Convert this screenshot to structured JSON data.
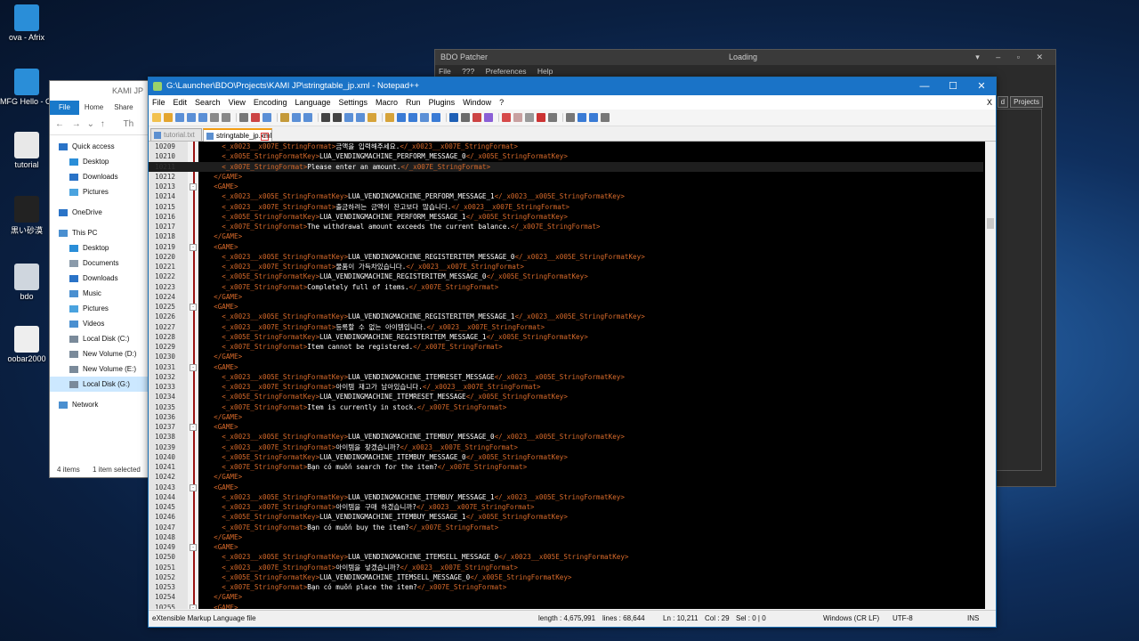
{
  "desktop": {
    "icons": [
      {
        "label": "ova - Afrix",
        "color": "#2a8ed8"
      },
      {
        "label": "MFG Hello - OMFG",
        "color": "#2a8ed8"
      },
      {
        "label": "tutorial",
        "color": "#e8e8e8"
      },
      {
        "label": "黒い砂漠",
        "color": "#222222"
      },
      {
        "label": "bdo",
        "color": "#cfd6de"
      },
      {
        "label": "oobar2000",
        "color": "#eeeeee"
      }
    ]
  },
  "bdo_patcher": {
    "title": "BDO Patcher",
    "status": "Loading",
    "menu": [
      "File",
      "???",
      "Preferences",
      "Help"
    ],
    "tabs": [
      "d",
      "Projects"
    ]
  },
  "explorer": {
    "title": "KAMI JP",
    "ribbon": {
      "file": "File",
      "home": "Home",
      "share": "Share"
    },
    "address": "Th",
    "nav": [
      {
        "label": "Quick access",
        "icon": "star-icon",
        "color": "#2a73c7",
        "sub": false
      },
      {
        "label": "Desktop",
        "icon": "desktop-icon",
        "color": "#2a8ed8",
        "sub": true
      },
      {
        "label": "Downloads",
        "icon": "download-icon",
        "color": "#2a73c7",
        "sub": true
      },
      {
        "label": "Pictures",
        "icon": "pictures-icon",
        "color": "#4aa3df",
        "sub": true
      },
      {
        "label": "OneDrive",
        "icon": "cloud-icon",
        "color": "#2a73c7",
        "sub": false,
        "gap": true
      },
      {
        "label": "This PC",
        "icon": "pc-icon",
        "color": "#4a8fd0",
        "sub": false,
        "gap": true
      },
      {
        "label": "Desktop",
        "icon": "desktop-icon",
        "color": "#2a8ed8",
        "sub": true
      },
      {
        "label": "Documents",
        "icon": "documents-icon",
        "color": "#8a9aaa",
        "sub": true
      },
      {
        "label": "Downloads",
        "icon": "download-icon",
        "color": "#2a73c7",
        "sub": true
      },
      {
        "label": "Music",
        "icon": "music-icon",
        "color": "#4a8fd0",
        "sub": true
      },
      {
        "label": "Pictures",
        "icon": "pictures-icon",
        "color": "#4aa3df",
        "sub": true
      },
      {
        "label": "Videos",
        "icon": "videos-icon",
        "color": "#4a8fd0",
        "sub": true
      },
      {
        "label": "Local Disk (C:)",
        "icon": "disk-icon",
        "color": "#7a8a9a",
        "sub": true
      },
      {
        "label": "New Volume (D:)",
        "icon": "disk-icon",
        "color": "#7a8a9a",
        "sub": true
      },
      {
        "label": "New Volume (E:)",
        "icon": "disk-icon",
        "color": "#7a8a9a",
        "sub": true
      },
      {
        "label": "Local Disk (G:)",
        "icon": "disk-icon",
        "color": "#7a8a9a",
        "sub": true,
        "selected": true
      },
      {
        "label": "Network",
        "icon": "network-icon",
        "color": "#4a8fd0",
        "sub": false,
        "gap": true
      }
    ],
    "status_items": "4 items",
    "status_selected": "1 item selected"
  },
  "notepad": {
    "title": "G:\\Launcher\\BDO\\Projects\\KAMI JP\\stringtable_jp.xml - Notepad++",
    "menu": [
      "File",
      "Edit",
      "Search",
      "View",
      "Encoding",
      "Language",
      "Settings",
      "Macro",
      "Run",
      "Plugins",
      "Window",
      "?"
    ],
    "menu_close": "X",
    "tabs": [
      {
        "label": "tutorial.txt",
        "active": false
      },
      {
        "label": "stringtable_jp.xml",
        "active": true
      }
    ],
    "accent": "#1a73c7",
    "tag_color": "#d96b2b",
    "lines": [
      {
        "no": "10209",
        "fold": "",
        "current": false,
        "segs": [
          [
            "t",
            "    <_x0023__x007E_StringFormat>"
          ],
          [
            "c",
            "금액을 입력해주세요."
          ],
          [
            "t",
            "</_x0023__x007E_StringFormat>"
          ]
        ]
      },
      {
        "no": "10210",
        "fold": "",
        "current": false,
        "segs": [
          [
            "t",
            "    <_x005E_StringFormatKey>"
          ],
          [
            "c",
            "LUA_VENDINGMACHINE_PERFORM_MESSAGE_0"
          ],
          [
            "t",
            "</_x005E_StringFormatKey>"
          ]
        ]
      },
      {
        "no": "10211",
        "fold": "",
        "current": true,
        "segs": [
          [
            "t",
            "    <_x007E_StringFormat>"
          ],
          [
            "c",
            "Please enter an amount."
          ],
          [
            "t",
            "</_x007E_StringFormat>"
          ]
        ]
      },
      {
        "no": "10212",
        "fold": "",
        "current": false,
        "segs": [
          [
            "t",
            "  </GAME>"
          ]
        ]
      },
      {
        "no": "10213",
        "fold": "-",
        "current": false,
        "segs": [
          [
            "t",
            "  <GAME>"
          ]
        ]
      },
      {
        "no": "10214",
        "fold": "",
        "current": false,
        "segs": [
          [
            "t",
            "    <_x0023__x005E_StringFormatKey>"
          ],
          [
            "c",
            "LUA_VENDINGMACHINE_PERFORM_MESSAGE_1"
          ],
          [
            "t",
            "</_x0023__x005E_StringFormatKey>"
          ]
        ]
      },
      {
        "no": "10215",
        "fold": "",
        "current": false,
        "segs": [
          [
            "t",
            "    <_x0023__x007E_StringFormat>"
          ],
          [
            "c",
            "출금하려는 금액이 잔고보다 많습니다."
          ],
          [
            "t",
            "</_x0023__x007E_StringFormat>"
          ]
        ]
      },
      {
        "no": "10216",
        "fold": "",
        "current": false,
        "segs": [
          [
            "t",
            "    <_x005E_StringFormatKey>"
          ],
          [
            "c",
            "LUA_VENDINGMACHINE_PERFORM_MESSAGE_1"
          ],
          [
            "t",
            "</_x005E_StringFormatKey>"
          ]
        ]
      },
      {
        "no": "10217",
        "fold": "",
        "current": false,
        "segs": [
          [
            "t",
            "    <_x007E_StringFormat>"
          ],
          [
            "c",
            "The withdrawal amount exceeds the current balance."
          ],
          [
            "t",
            "</_x007E_StringFormat>"
          ]
        ]
      },
      {
        "no": "10218",
        "fold": "",
        "current": false,
        "segs": [
          [
            "t",
            "  </GAME>"
          ]
        ]
      },
      {
        "no": "10219",
        "fold": "-",
        "current": false,
        "segs": [
          [
            "t",
            "  <GAME>"
          ]
        ]
      },
      {
        "no": "10220",
        "fold": "",
        "current": false,
        "segs": [
          [
            "t",
            "    <_x0023__x005E_StringFormatKey>"
          ],
          [
            "c",
            "LUA_VENDINGMACHINE_REGISTERITEM_MESSAGE_0"
          ],
          [
            "t",
            "</_x0023__x005E_StringFormatKey>"
          ]
        ]
      },
      {
        "no": "10221",
        "fold": "",
        "current": false,
        "segs": [
          [
            "t",
            "    <_x0023__x007E_StringFormat>"
          ],
          [
            "c",
            "물품이 가득차있습니다."
          ],
          [
            "t",
            "</_x0023__x007E_StringFormat>"
          ]
        ]
      },
      {
        "no": "10222",
        "fold": "",
        "current": false,
        "segs": [
          [
            "t",
            "    <_x005E_StringFormatKey>"
          ],
          [
            "c",
            "LUA_VENDINGMACHINE_REGISTERITEM_MESSAGE_0"
          ],
          [
            "t",
            "</_x005E_StringFormatKey>"
          ]
        ]
      },
      {
        "no": "10223",
        "fold": "",
        "current": false,
        "segs": [
          [
            "t",
            "    <_x007E_StringFormat>"
          ],
          [
            "c",
            "Completely full of items."
          ],
          [
            "t",
            "</_x007E_StringFormat>"
          ]
        ]
      },
      {
        "no": "10224",
        "fold": "",
        "current": false,
        "segs": [
          [
            "t",
            "  </GAME>"
          ]
        ]
      },
      {
        "no": "10225",
        "fold": "-",
        "current": false,
        "segs": [
          [
            "t",
            "  <GAME>"
          ]
        ]
      },
      {
        "no": "10226",
        "fold": "",
        "current": false,
        "segs": [
          [
            "t",
            "    <_x0023__x005E_StringFormatKey>"
          ],
          [
            "c",
            "LUA_VENDINGMACHINE_REGISTERITEM_MESSAGE_1"
          ],
          [
            "t",
            "</_x0023__x005E_StringFormatKey>"
          ]
        ]
      },
      {
        "no": "10227",
        "fold": "",
        "current": false,
        "segs": [
          [
            "t",
            "    <_x0023__x007E_StringFormat>"
          ],
          [
            "c",
            "등록할 수 없는 아이템입니다."
          ],
          [
            "t",
            "</_x0023__x007E_StringFormat>"
          ]
        ]
      },
      {
        "no": "10228",
        "fold": "",
        "current": false,
        "segs": [
          [
            "t",
            "    <_x005E_StringFormatKey>"
          ],
          [
            "c",
            "LUA_VENDINGMACHINE_REGISTERITEM_MESSAGE_1"
          ],
          [
            "t",
            "</_x005E_StringFormatKey>"
          ]
        ]
      },
      {
        "no": "10229",
        "fold": "",
        "current": false,
        "segs": [
          [
            "t",
            "    <_x007E_StringFormat>"
          ],
          [
            "c",
            "Item cannot be registered."
          ],
          [
            "t",
            "</_x007E_StringFormat>"
          ]
        ]
      },
      {
        "no": "10230",
        "fold": "",
        "current": false,
        "segs": [
          [
            "t",
            "  </GAME>"
          ]
        ]
      },
      {
        "no": "10231",
        "fold": "-",
        "current": false,
        "segs": [
          [
            "t",
            "  <GAME>"
          ]
        ]
      },
      {
        "no": "10232",
        "fold": "",
        "current": false,
        "segs": [
          [
            "t",
            "    <_x0023__x005E_StringFormatKey>"
          ],
          [
            "c",
            "LUA_VENDINGMACHINE_ITEMRESET_MESSAGE"
          ],
          [
            "t",
            "</_x0023__x005E_StringFormatKey>"
          ]
        ]
      },
      {
        "no": "10233",
        "fold": "",
        "current": false,
        "segs": [
          [
            "t",
            "    <_x0023__x007E_StringFormat>"
          ],
          [
            "c",
            "아이템 재고가 남아있습니다."
          ],
          [
            "t",
            "</_x0023__x007E_StringFormat>"
          ]
        ]
      },
      {
        "no": "10234",
        "fold": "",
        "current": false,
        "segs": [
          [
            "t",
            "    <_x005E_StringFormatKey>"
          ],
          [
            "c",
            "LUA_VENDINGMACHINE_ITEMRESET_MESSAGE"
          ],
          [
            "t",
            "</_x005E_StringFormatKey>"
          ]
        ]
      },
      {
        "no": "10235",
        "fold": "",
        "current": false,
        "segs": [
          [
            "t",
            "    <_x007E_StringFormat>"
          ],
          [
            "c",
            "Item is currently in stock."
          ],
          [
            "t",
            "</_x007E_StringFormat>"
          ]
        ]
      },
      {
        "no": "10236",
        "fold": "",
        "current": false,
        "segs": [
          [
            "t",
            "  </GAME>"
          ]
        ]
      },
      {
        "no": "10237",
        "fold": "-",
        "current": false,
        "segs": [
          [
            "t",
            "  <GAME>"
          ]
        ]
      },
      {
        "no": "10238",
        "fold": "",
        "current": false,
        "segs": [
          [
            "t",
            "    <_x0023__x005E_StringFormatKey>"
          ],
          [
            "c",
            "LUA_VENDINGMACHINE_ITEMBUY_MESSAGE_0"
          ],
          [
            "t",
            "</_x0023__x005E_StringFormatKey>"
          ]
        ]
      },
      {
        "no": "10239",
        "fold": "",
        "current": false,
        "segs": [
          [
            "t",
            "    <_x0023__x007E_StringFormat>"
          ],
          [
            "c",
            "아이템을 찾겠습니까?"
          ],
          [
            "t",
            "</_x0023__x007E_StringFormat>"
          ]
        ]
      },
      {
        "no": "10240",
        "fold": "",
        "current": false,
        "segs": [
          [
            "t",
            "    <_x005E_StringFormatKey>"
          ],
          [
            "c",
            "LUA_VENDINGMACHINE_ITEMBUY_MESSAGE_0"
          ],
          [
            "t",
            "</_x005E_StringFormatKey>"
          ]
        ]
      },
      {
        "no": "10241",
        "fold": "",
        "current": false,
        "segs": [
          [
            "t",
            "    <_x007E_StringFormat>"
          ],
          [
            "c",
            "Bạn có muốn search for the item?"
          ],
          [
            "t",
            "</_x007E_StringFormat>"
          ]
        ]
      },
      {
        "no": "10242",
        "fold": "",
        "current": false,
        "segs": [
          [
            "t",
            "  </GAME>"
          ]
        ]
      },
      {
        "no": "10243",
        "fold": "-",
        "current": false,
        "segs": [
          [
            "t",
            "  <GAME>"
          ]
        ]
      },
      {
        "no": "10244",
        "fold": "",
        "current": false,
        "segs": [
          [
            "t",
            "    <_x0023__x005E_StringFormatKey>"
          ],
          [
            "c",
            "LUA_VENDINGMACHINE_ITEMBUY_MESSAGE_1"
          ],
          [
            "t",
            "</_x0023__x005E_StringFormatKey>"
          ]
        ]
      },
      {
        "no": "10245",
        "fold": "",
        "current": false,
        "segs": [
          [
            "t",
            "    <_x0023__x007E_StringFormat>"
          ],
          [
            "c",
            "아이템을 구매 하겠습니까?"
          ],
          [
            "t",
            "</_x0023__x007E_StringFormat>"
          ]
        ]
      },
      {
        "no": "10246",
        "fold": "",
        "current": false,
        "segs": [
          [
            "t",
            "    <_x005E_StringFormatKey>"
          ],
          [
            "c",
            "LUA_VENDINGMACHINE_ITEMBUY_MESSAGE_1"
          ],
          [
            "t",
            "</_x005E_StringFormatKey>"
          ]
        ]
      },
      {
        "no": "10247",
        "fold": "",
        "current": false,
        "segs": [
          [
            "t",
            "    <_x007E_StringFormat>"
          ],
          [
            "c",
            "Bạn có muốn buy the item?"
          ],
          [
            "t",
            "</_x007E_StringFormat>"
          ]
        ]
      },
      {
        "no": "10248",
        "fold": "",
        "current": false,
        "segs": [
          [
            "t",
            "  </GAME>"
          ]
        ]
      },
      {
        "no": "10249",
        "fold": "-",
        "current": false,
        "segs": [
          [
            "t",
            "  <GAME>"
          ]
        ]
      },
      {
        "no": "10250",
        "fold": "",
        "current": false,
        "segs": [
          [
            "t",
            "    <_x0023__x005E_StringFormatKey>"
          ],
          [
            "c",
            "LUA_VENDINGMACHINE_ITEMSELL_MESSAGE_0"
          ],
          [
            "t",
            "</_x0023__x005E_StringFormatKey>"
          ]
        ]
      },
      {
        "no": "10251",
        "fold": "",
        "current": false,
        "segs": [
          [
            "t",
            "    <_x0023__x007E_StringFormat>"
          ],
          [
            "c",
            "아이템을 넣겠습니까?"
          ],
          [
            "t",
            "</_x0023__x007E_StringFormat>"
          ]
        ]
      },
      {
        "no": "10252",
        "fold": "",
        "current": false,
        "segs": [
          [
            "t",
            "    <_x005E_StringFormatKey>"
          ],
          [
            "c",
            "LUA_VENDINGMACHINE_ITEMSELL_MESSAGE_0"
          ],
          [
            "t",
            "</_x005E_StringFormatKey>"
          ]
        ]
      },
      {
        "no": "10253",
        "fold": "",
        "current": false,
        "segs": [
          [
            "t",
            "    <_x007E_StringFormat>"
          ],
          [
            "c",
            "Bạn có muốn place the item?"
          ],
          [
            "t",
            "</_x007E_StringFormat>"
          ]
        ]
      },
      {
        "no": "10254",
        "fold": "",
        "current": false,
        "segs": [
          [
            "t",
            "  </GAME>"
          ]
        ]
      },
      {
        "no": "10255",
        "fold": "-",
        "current": false,
        "segs": [
          [
            "t",
            "  <GAME>"
          ]
        ]
      }
    ],
    "status": {
      "filetype": "eXtensible Markup Language file",
      "length": "length : 4,675,991",
      "lines": "lines : 68,644",
      "ln": "Ln : 10,211",
      "col": "Col : 29",
      "sel": "Sel : 0 | 0",
      "eol": "Windows (CR LF)",
      "encoding": "UTF-8",
      "mode": "INS"
    }
  }
}
